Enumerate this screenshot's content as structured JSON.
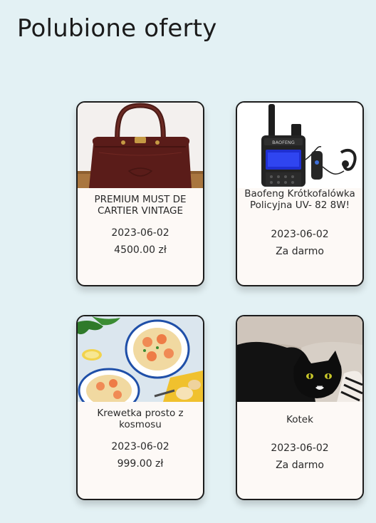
{
  "page": {
    "title": "Polubione oferty"
  },
  "offers": [
    {
      "title": "PREMIUM MUST DE CARTIER VINTAGE",
      "date": "2023-06-02",
      "price": "4500.00 zł",
      "image": "handbag-photo"
    },
    {
      "title": "Baofeng Krótkofalówka Policyjna UV- 82 8W!",
      "date": "2023-06-02",
      "price": "Za darmo",
      "image": "walkie-talkie-photo"
    },
    {
      "title": "Krewetka prosto z kosmosu",
      "date": "2023-06-02",
      "price": "999.00 zł",
      "image": "shrimp-dish-photo"
    },
    {
      "title": "Kotek",
      "date": "2023-06-02",
      "price": "Za darmo",
      "image": "black-cat-photo"
    }
  ],
  "colors": {
    "background": "#e3f1f4",
    "card": "#fdf9f6",
    "border": "#1c1c1c"
  }
}
